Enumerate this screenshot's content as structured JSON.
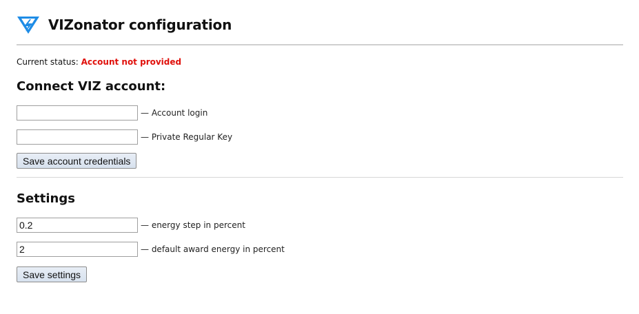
{
  "header": {
    "title": "VIZonator configuration",
    "logo_icon": "viz-logo-icon",
    "logo_color": "#1e8ce6"
  },
  "status": {
    "label": "Current status:",
    "value": "Account not provided",
    "value_color": "#e0100b"
  },
  "account": {
    "heading": "Connect VIZ account:",
    "login": {
      "value": "",
      "label": "— Account login"
    },
    "key": {
      "value": "",
      "label": "— Private Regular Key"
    },
    "save_label": "Save account credentials"
  },
  "settings": {
    "heading": "Settings",
    "energy_step": {
      "value": "0.2",
      "label": "— energy step in percent"
    },
    "award_energy": {
      "value": "2",
      "label": "— default award energy in percent"
    },
    "save_label": "Save settings"
  }
}
